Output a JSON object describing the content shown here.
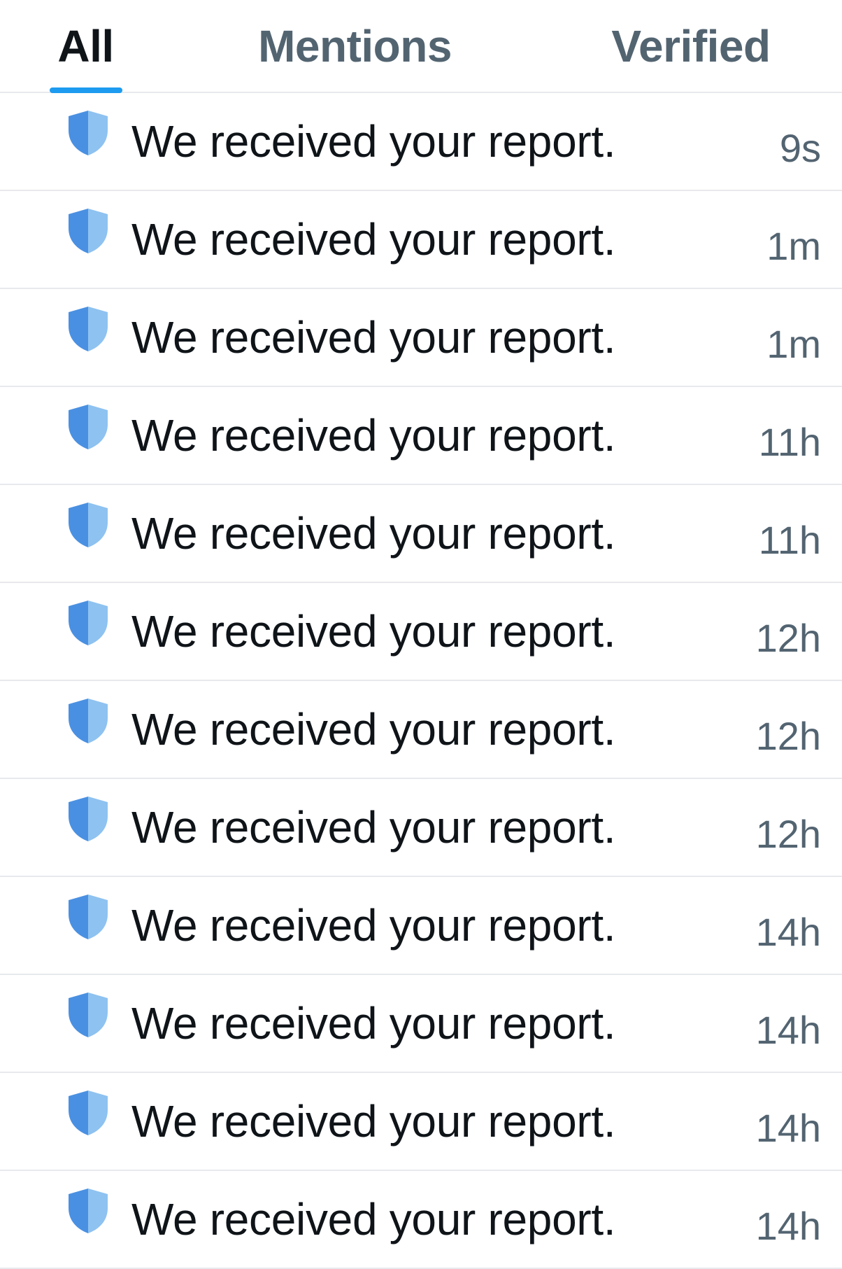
{
  "tabs": [
    {
      "label": "All",
      "active": true
    },
    {
      "label": "Mentions",
      "active": false
    },
    {
      "label": "Verified",
      "active": false
    }
  ],
  "colors": {
    "accent": "#1d9bf0",
    "shield_dark": "#4a90e2",
    "shield_light": "#8ec2f0",
    "text_primary": "#0f1419",
    "text_secondary": "#536471",
    "divider": "#e7e9ec"
  },
  "notifications": [
    {
      "icon": "shield-icon",
      "message": "We received your report.",
      "time": "9s"
    },
    {
      "icon": "shield-icon",
      "message": "We received your report.",
      "time": "1m"
    },
    {
      "icon": "shield-icon",
      "message": "We received your report.",
      "time": "1m"
    },
    {
      "icon": "shield-icon",
      "message": "We received your report.",
      "time": "11h"
    },
    {
      "icon": "shield-icon",
      "message": "We received your report.",
      "time": "11h"
    },
    {
      "icon": "shield-icon",
      "message": "We received your report.",
      "time": "12h"
    },
    {
      "icon": "shield-icon",
      "message": "We received your report.",
      "time": "12h"
    },
    {
      "icon": "shield-icon",
      "message": "We received your report.",
      "time": "12h"
    },
    {
      "icon": "shield-icon",
      "message": "We received your report.",
      "time": "14h"
    },
    {
      "icon": "shield-icon",
      "message": "We received your report.",
      "time": "14h"
    },
    {
      "icon": "shield-icon",
      "message": "We received your report.",
      "time": "14h"
    },
    {
      "icon": "shield-icon",
      "message": "We received your report.",
      "time": "14h"
    }
  ]
}
